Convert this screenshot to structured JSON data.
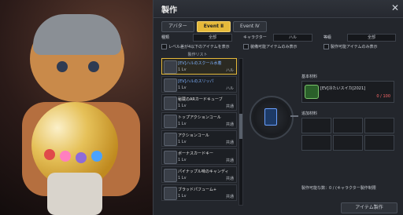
{
  "window": {
    "title": "製作"
  },
  "tabs": [
    {
      "label": "アバター"
    },
    {
      "label": "Event Ⅱ"
    },
    {
      "label": "Event Ⅳ"
    }
  ],
  "filters": [
    {
      "label": "種類",
      "value": "全部"
    },
    {
      "label": "キャラクター",
      "value": "ハル"
    },
    {
      "label": "等級",
      "value": "全部"
    }
  ],
  "checkboxes": [
    {
      "label": "レベル差が4以下のアイテムを表示"
    },
    {
      "label": "装備可能アイテムのみ表示"
    },
    {
      "label": "製作可能アイテムのみ表示"
    }
  ],
  "recipe_list": {
    "title": "製作リスト",
    "items": [
      {
        "name": "[EV]ハルのスクール水着",
        "level": "1",
        "lv_label": "Lv",
        "tag": "ハル"
      },
      {
        "name": "[EV]ハルのスリッパ",
        "level": "1",
        "lv_label": "Lv",
        "tag": "ハル"
      },
      {
        "name": "秘蔵のARカードキューブ",
        "level": "1",
        "lv_label": "Lv",
        "tag": "共通"
      },
      {
        "name": "トップアクションコール",
        "level": "1",
        "lv_label": "Lv",
        "tag": "共通"
      },
      {
        "name": "アクションコール",
        "level": "1",
        "lv_label": "Lv",
        "tag": "共通"
      },
      {
        "name": "ボーナスカードキー",
        "level": "1",
        "lv_label": "Lv",
        "tag": "共通"
      },
      {
        "name": "パイナップル味のキャンディ",
        "level": "1",
        "lv_label": "Lv",
        "tag": "共通"
      },
      {
        "name": "ブラッドパフューム+",
        "level": "1",
        "lv_label": "Lv",
        "tag": "共通"
      }
    ]
  },
  "materials": {
    "required_title": "基本材料",
    "items": [
      {
        "name": "[EV]冷たいスイカ[2021]",
        "count": "0 / 100"
      }
    ],
    "additional_title": "追加材料"
  },
  "footer": {
    "possible_label": "製作可能な数：0 / (キャラクター製作制限",
    "button_label": "アイテム製作"
  }
}
